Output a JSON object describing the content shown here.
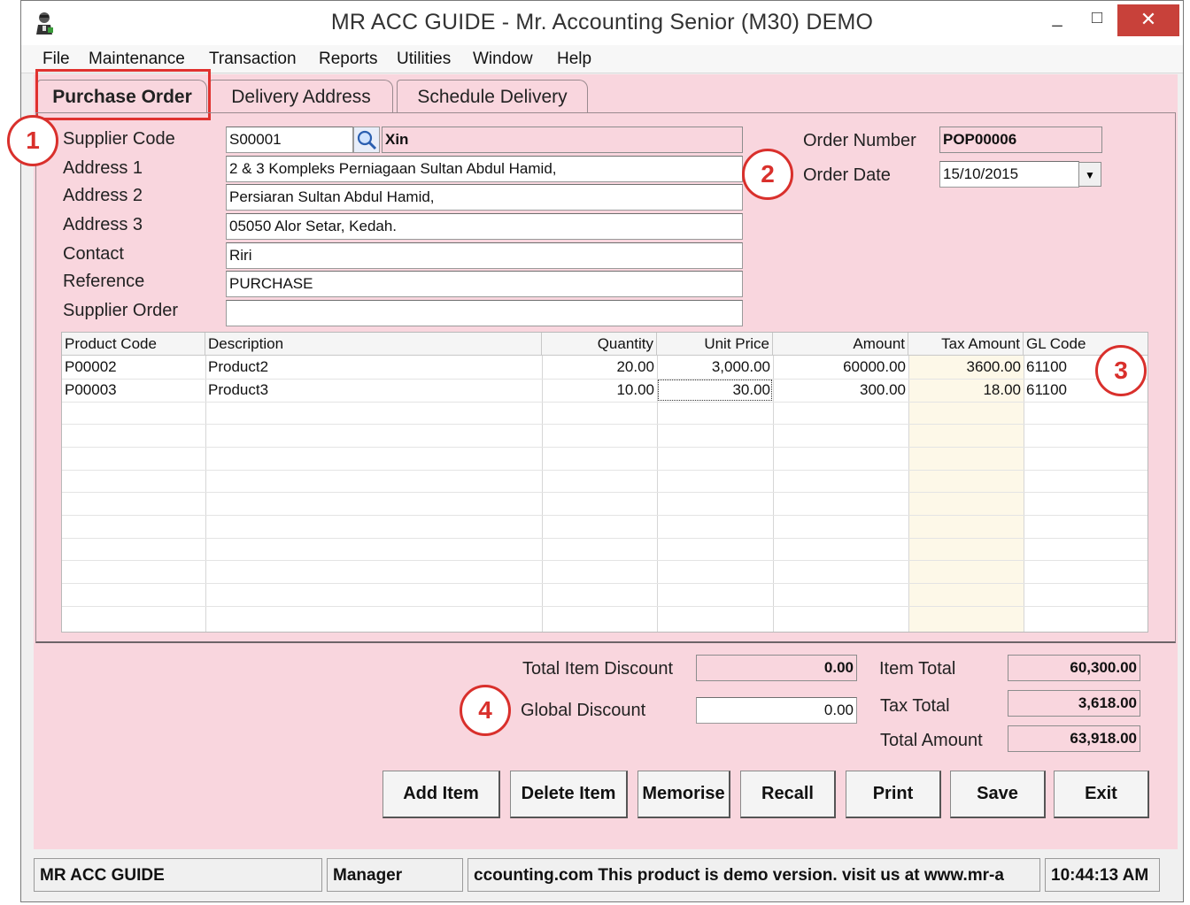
{
  "window": {
    "title": "MR ACC GUIDE - Mr. Accounting Senior (M30) DEMO",
    "min_glyph": "_",
    "max_glyph": "□",
    "close_glyph": "✕"
  },
  "menu": [
    "File",
    "Maintenance",
    "Transaction",
    "Reports",
    "Utilities",
    "Window",
    "Help"
  ],
  "tabs": [
    "Purchase Order",
    "Delivery Address",
    "Schedule Delivery"
  ],
  "form": {
    "supplier_code_label": "Supplier Code",
    "supplier_code": "S00001",
    "supplier_name": "Xin",
    "address1_label": "Address 1",
    "address1": "2 & 3 Kompleks Perniagaan Sultan Abdul Hamid,",
    "address2_label": "Address 2",
    "address2": "Persiaran Sultan Abdul Hamid,",
    "address3_label": "Address 3",
    "address3": "05050 Alor Setar, Kedah.",
    "contact_label": "Contact",
    "contact": "Riri",
    "reference_label": "Reference",
    "reference": "PURCHASE",
    "supplier_order_label": "Supplier Order",
    "supplier_order": "",
    "order_number_label": "Order Number",
    "order_number": "POP00006",
    "order_date_label": "Order Date",
    "order_date": "15/10/2015"
  },
  "grid": {
    "headers": [
      "Product Code",
      "Description",
      "Quantity",
      "Unit Price",
      "Amount",
      "Tax Amount",
      "GL Code"
    ],
    "rows": [
      [
        "P00002",
        "Product2",
        "20.00",
        "3,000.00",
        "60000.00",
        "3600.00",
        "61100"
      ],
      [
        "P00003",
        "Product3",
        "10.00",
        "30.00",
        "300.00",
        "18.00",
        "61100"
      ]
    ]
  },
  "totals": {
    "total_item_discount_label": "Total Item Discount",
    "total_item_discount": "0.00",
    "global_discount_label": "Global Discount",
    "global_discount": "0.00",
    "item_total_label": "Item Total",
    "item_total": "60,300.00",
    "tax_total_label": "Tax Total",
    "tax_total": "3,618.00",
    "total_amount_label": "Total Amount",
    "total_amount": "63,918.00"
  },
  "buttons": [
    "Add Item",
    "Delete Item",
    "Memorise",
    "Recall",
    "Print",
    "Save",
    "Exit"
  ],
  "badges": [
    "1",
    "2",
    "3",
    "4"
  ],
  "status": {
    "company": "MR ACC GUIDE",
    "user": "Manager",
    "message": "ccounting.com This product is demo version.  visit us at www.mr-a",
    "time": "10:44:13 AM"
  },
  "colors": {
    "form_background": "#f9d6de",
    "annotation_red": "#d9302c",
    "close_button": "#c8413a"
  }
}
